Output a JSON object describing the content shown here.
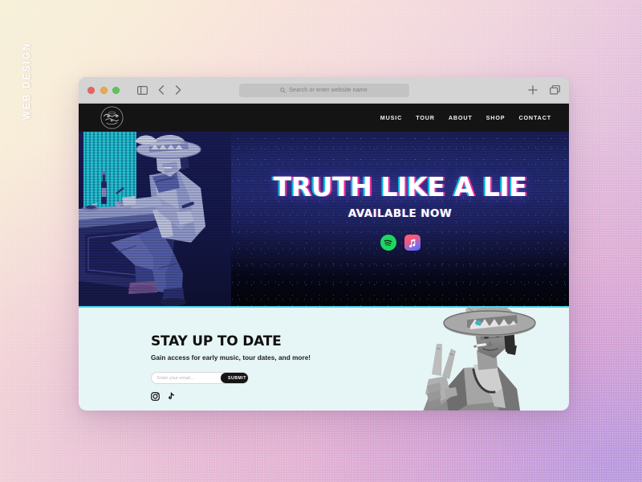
{
  "side_label": {
    "text": "WEB DESIGN"
  },
  "browser": {
    "window_controls": [
      {
        "name": "close",
        "color": "#e9645f"
      },
      {
        "name": "minimize",
        "color": "#e9a84c"
      },
      {
        "name": "maximize",
        "color": "#5fc35a"
      }
    ],
    "toolbar": {
      "sidebar_toggle": "sidebar-icon",
      "back": "chevron-left-icon",
      "forward": "chevron-right-icon",
      "new_tab": "plus-icon",
      "tab_overview": "tab-overview-icon"
    },
    "address_bar": {
      "placeholder": "Search or enter website name",
      "value": "",
      "icon": "search-icon"
    }
  },
  "site": {
    "logo": {
      "name": "band-logo-badge",
      "alt": "Script circular band logo"
    },
    "nav": [
      {
        "label": "MUSIC"
      },
      {
        "label": "TOUR"
      },
      {
        "label": "ABOUT"
      },
      {
        "label": "SHOP"
      },
      {
        "label": "CONTACT"
      }
    ],
    "hero": {
      "title": "TRUTH LIKE A LIE",
      "subtitle": "AVAILABLE NOW",
      "streaming": [
        {
          "name": "spotify",
          "label": "Spotify",
          "color": "#1ed760"
        },
        {
          "name": "apple-music",
          "label": "Apple Music",
          "color": "#fa5d77"
        }
      ],
      "illustration": "cowboy-at-bar-duotone",
      "bg_color": "#252c78"
    },
    "newsletter": {
      "title": "STAY UP TO DATE",
      "description": "Gain access for early music, tour dates, and more!",
      "email_placeholder": "Enter your email...",
      "email_value": "",
      "submit_label": "SUBMIT",
      "social": [
        {
          "name": "instagram"
        },
        {
          "name": "tiktok"
        }
      ],
      "illustration": "cowboy-peace-sign-grayscale",
      "bg_color": "#e6f5f6",
      "accent_color": "#4fd3e8"
    }
  },
  "backdrop": {
    "gradient_start": "#f6f0d8",
    "gradient_mid": "#f0d4dd",
    "gradient_end": "#c0a2d8"
  }
}
